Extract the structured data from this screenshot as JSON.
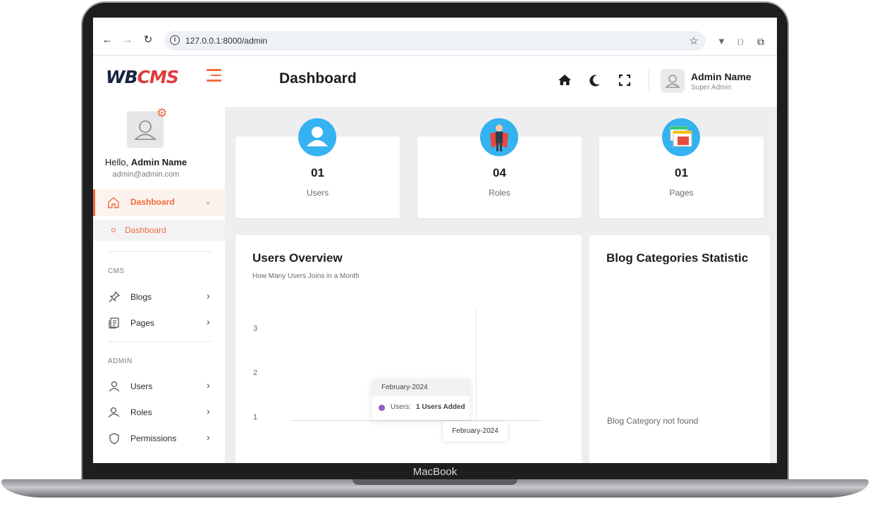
{
  "device": {
    "label": "MacBook"
  },
  "browser": {
    "url": "127.0.0.1:8000/admin"
  },
  "header": {
    "logo_main": "WB",
    "logo_accent": "CMS",
    "title": "Dashboard",
    "user_name": "Admin Name",
    "user_role": "Super Admin"
  },
  "sidebar": {
    "hello_prefix": "Hello,",
    "hello_name": "Admin Name",
    "email": "admin@admin.com",
    "active_item": "Dashboard",
    "sub_item": "Dashboard",
    "sections": [
      {
        "heading": "CMS",
        "items": [
          "Blogs",
          "Pages"
        ]
      },
      {
        "heading": "ADMIN",
        "items": [
          "Users",
          "Roles",
          "Permissions"
        ]
      }
    ]
  },
  "stats": [
    {
      "value": "01",
      "label": "Users"
    },
    {
      "value": "04",
      "label": "Roles"
    },
    {
      "value": "01",
      "label": "Pages"
    }
  ],
  "users_overview": {
    "title": "Users Overview",
    "subtitle": "How Many Users Joins in a Month",
    "tooltip_title": "February-2024",
    "tooltip_label": "Users:",
    "tooltip_value": "1 Users Added",
    "x_tooltip": "February-2024"
  },
  "chart_data": {
    "type": "line",
    "title": "Users Overview",
    "subtitle": "How Many Users Joins in a Month",
    "x": [
      "February-2024"
    ],
    "series": [
      {
        "name": "Users",
        "values": [
          1
        ]
      }
    ],
    "yticks": [
      "3",
      "2",
      "1"
    ],
    "color": "#8e63b8"
  },
  "blog_stats": {
    "title": "Blog Categories Statistic",
    "empty": "Blog Category not found"
  },
  "colors": {
    "accent": "#f26b3a",
    "badge": "#35b2f0"
  }
}
